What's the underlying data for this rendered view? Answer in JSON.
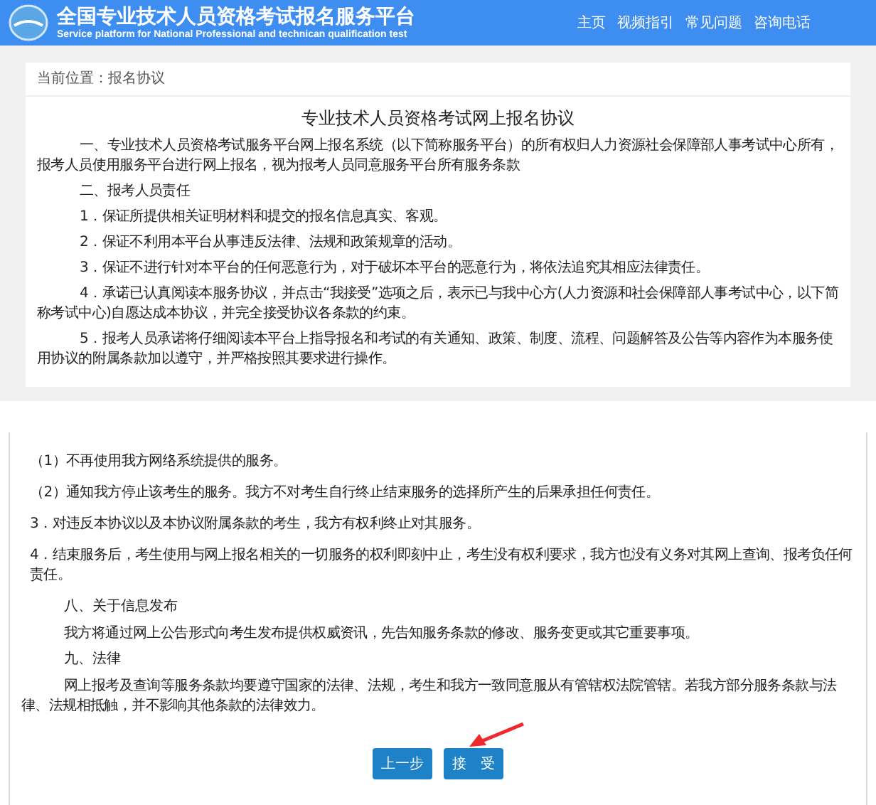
{
  "header": {
    "title": "全国专业技术人员资格考试报名服务平台",
    "subtitle": "Service platform for National Professional and technican qualification test",
    "nav": [
      "主页",
      "视频指引",
      "常见问题",
      "咨询电话"
    ]
  },
  "breadcrumb": "当前位置：报名协议",
  "agreement_top": [
    {
      "kind": "title",
      "text": "专业技术人员资格考试网上报名协议"
    },
    {
      "kind": "para",
      "text": "一、专业技术人员资格考试服务平台网上报名系统（以下简称服务平台）的所有权归人力资源社会保障部人事考试中心所有，报考人员使用服务平台进行网上报名，视为报考人员同意服务平台所有服务条款"
    },
    {
      "kind": "para",
      "text": "二、报考人员责任"
    },
    {
      "kind": "para",
      "text": "1．保证所提供相关证明材料和提交的报名信息真实、客观。"
    },
    {
      "kind": "para",
      "text": "2．保证不利用本平台从事违反法律、法规和政策规章的活动。"
    },
    {
      "kind": "para",
      "text": "3．保证不进行针对本平台的任何恶意行为，对于破坏本平台的恶意行为，将依法追究其相应法律责任。"
    },
    {
      "kind": "para",
      "text": "4．承诺已认真阅读本服务协议，并点击“我接受”选项之后，表示已与我中心方(人力资源和社会保障部人事考试中心，以下简称考试中心)自愿达成本协议，并完全接受协议各条款的约束。"
    },
    {
      "kind": "para",
      "text": "5．报考人员承诺将仔细阅读本平台上指导报名和考试的有关通知、政策、制度、流程、问题解答及公告等内容作为本服务使用协议的附属条款加以遵守，并严格按照其要求进行操作。"
    }
  ],
  "agreement_bottom": [
    {
      "kind": "item",
      "text": "（1）不再使用我方网络系统提供的服务。"
    },
    {
      "kind": "item",
      "text": "（2）通知我方停止该考生的服务。我方不对考生自行终止结束服务的选择所产生的后果承担任何责任。"
    },
    {
      "kind": "item",
      "text": "3．对违反本协议以及本协议附属条款的考生，我方有权利终止对其服务。"
    },
    {
      "kind": "item",
      "text": "4．结束服务后，考生使用与网上报名相关的一切服务的权利即刻中止，考生没有权利要求，我方也没有义务对其网上查询、报考负任何责任。"
    },
    {
      "kind": "heading",
      "text": "八、关于信息发布"
    },
    {
      "kind": "para",
      "text": "我方将通过网上公告形式向考生发布提供权威资讯，先告知服务条款的修改、服务变更或其它重要事项。"
    },
    {
      "kind": "heading",
      "text": "九、法律"
    },
    {
      "kind": "para",
      "text": "网上报考及查询等服务条款均要遵守国家的法律、法规，考生和我方一致同意服从有管辖权法院管辖。若我方部分服务条款与法律、法规相抵触，并不影响其他条款的法律效力。"
    }
  ],
  "buttons": [
    "上一步",
    "接　受"
  ]
}
